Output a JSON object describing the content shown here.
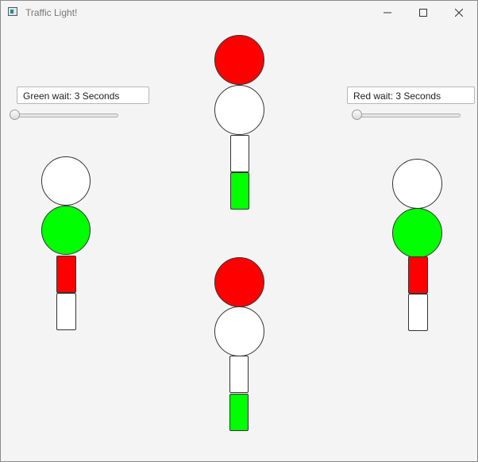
{
  "window": {
    "title": "Traffic Light!",
    "minimize_icon": "minimize-icon",
    "maximize_icon": "maximize-icon",
    "close_icon": "close-icon"
  },
  "controls": {
    "green_wait": {
      "text": "Green wait: 3 Seconds",
      "slider_value": 0
    },
    "red_wait": {
      "text": "Red wait: 3 Seconds",
      "slider_value": 0
    }
  },
  "colors": {
    "red": "#ff0000",
    "green": "#00ff00",
    "off": "#ffffff"
  },
  "lights": {
    "top": [
      "red",
      "off",
      "off",
      "green"
    ],
    "bottom": [
      "red",
      "off",
      "off",
      "green"
    ],
    "left": [
      "off",
      "green",
      "red",
      "off"
    ],
    "right": [
      "off",
      "green",
      "red",
      "off"
    ]
  }
}
